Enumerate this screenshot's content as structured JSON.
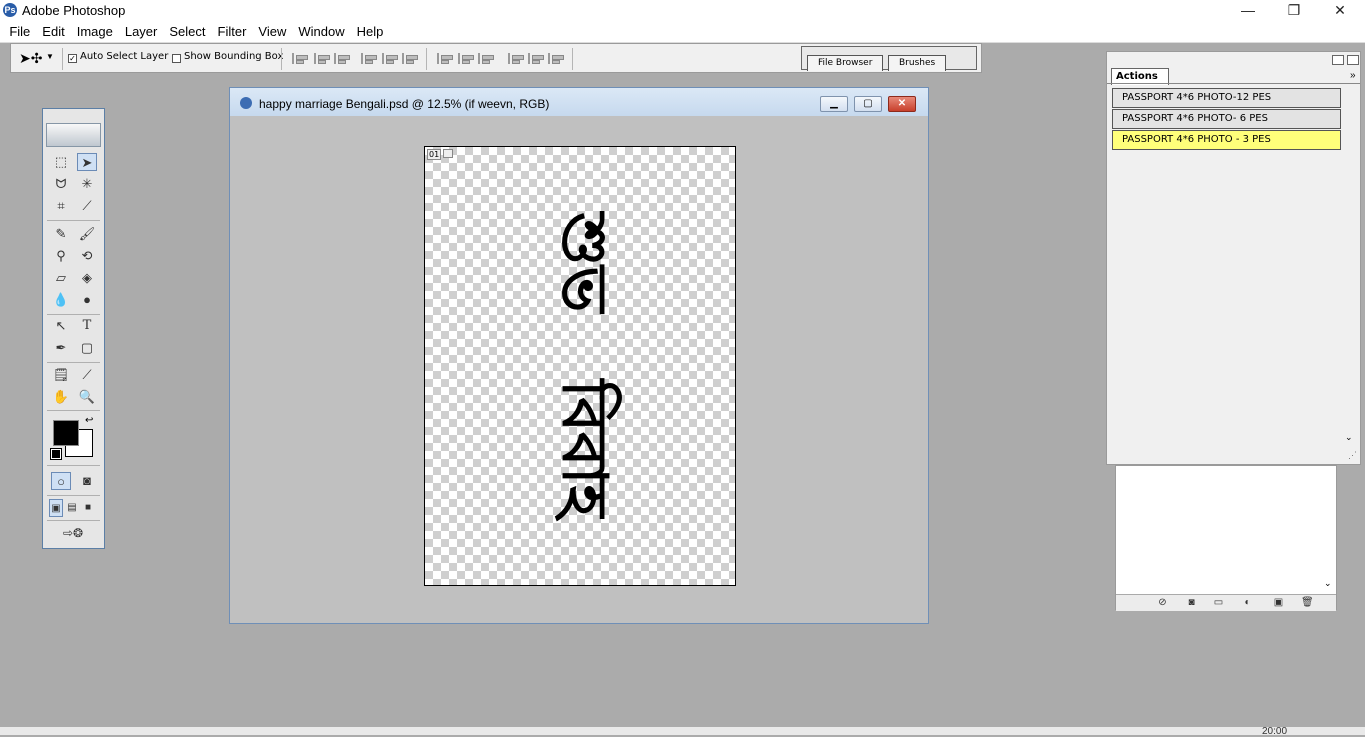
{
  "app": {
    "title": "Adobe Photoshop",
    "icon": "photoshop-icon"
  },
  "window_controls": {
    "minimize": "—",
    "restore": "❐",
    "close": "✕"
  },
  "menu": [
    "File",
    "Edit",
    "Image",
    "Layer",
    "Select",
    "Filter",
    "View",
    "Window",
    "Help"
  ],
  "options": {
    "auto_select_label": "Auto Select Layer",
    "auto_select_checked": true,
    "bounding_box_label": "Show Bounding Box",
    "bounding_box_checked": false
  },
  "palette_well": {
    "tabs": [
      "File Browser",
      "Brushes"
    ]
  },
  "document": {
    "title": "happy marriage Bengali.psd @ 12.5% (if weevn, RGB)",
    "badge": "01",
    "artwork_line1": "শুভ",
    "artwork_line2": "বিবাহ"
  },
  "actions": {
    "tab_label": "Actions",
    "items": [
      {
        "label": "PASSPORT 4*6 PHOTO-12 PES",
        "selected": false
      },
      {
        "label": "PASSPORT 4*6 PHOTO- 6 PES",
        "selected": false
      },
      {
        "label": "PASSPORT 4*6 PHOTO - 3 PES",
        "selected": true
      }
    ],
    "highlight_color": "#ffff7a"
  },
  "colors": {
    "foreground": "#000000",
    "background": "#ffffff",
    "workspace": "#ababab"
  },
  "tools": [
    "marquee-icon",
    "move-icon",
    "lasso-icon",
    "magic-wand-icon",
    "crop-icon",
    "slice-icon",
    "healing-brush-icon",
    "brush-icon",
    "clone-stamp-icon",
    "history-brush-icon",
    "eraser-icon",
    "paint-bucket-icon",
    "blur-icon",
    "dodge-icon",
    "path-select-icon",
    "type-icon",
    "pen-icon",
    "shape-icon",
    "notes-icon",
    "eyedropper-icon",
    "hand-icon",
    "zoom-icon"
  ],
  "taskbar": {
    "clock": "20:00"
  }
}
